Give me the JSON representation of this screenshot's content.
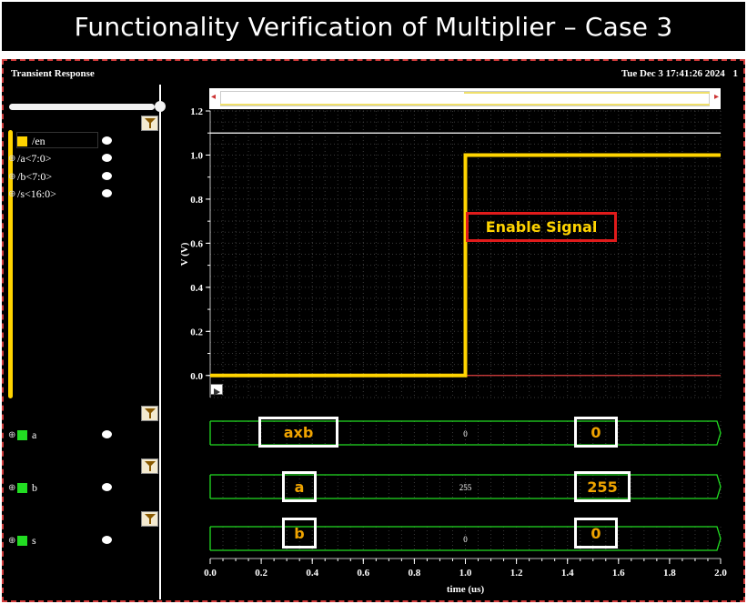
{
  "slide": {
    "title": "Functionality Verification of Multiplier – Case 3"
  },
  "window": {
    "title": "Transient Response",
    "datetime": "Tue Dec 3 17:41:26 2024",
    "subwindow_index": "1"
  },
  "sidebar": {
    "filter_icon": "funnel-icon",
    "signals": [
      {
        "name": "/en",
        "color": "#ffd400",
        "expand": ""
      },
      {
        "name": "/a<7:0>",
        "color": "",
        "expand": "⊕"
      },
      {
        "name": "/b<7:0>",
        "color": "",
        "expand": "⊕"
      },
      {
        "name": "/s<16:0>",
        "color": "",
        "expand": "⊕"
      }
    ],
    "bus_signals": [
      {
        "name": "a",
        "color": "#22dd22",
        "expand": "⊕"
      },
      {
        "name": "b",
        "color": "#22dd22",
        "expand": "⊕"
      },
      {
        "name": "s",
        "color": "#22dd22",
        "expand": "⊕"
      }
    ]
  },
  "annotations": {
    "enable_label": "Enable Signal",
    "bus_left_labels": [
      "axb",
      "a",
      "b"
    ],
    "bus_right_labels": [
      "0",
      "255",
      "0"
    ]
  },
  "chart_data": {
    "type": "line",
    "xlabel": "time (us)",
    "ylabel": "V (V)",
    "xlim": [
      0.0,
      2.0
    ],
    "ylim": [
      -0.1,
      1.2
    ],
    "x_ticks": [
      "0.0",
      "0.2",
      "0.4",
      "0.6",
      "0.8",
      "1.0",
      "1.2",
      "1.4",
      "1.6",
      "1.8",
      "2.0"
    ],
    "y_ticks": [
      "0.0",
      "0.2",
      "0.4",
      "0.6",
      "0.8",
      "1.0",
      "1.2"
    ],
    "grid": true,
    "series": [
      {
        "name": "/en",
        "color": "#ffd400",
        "points": [
          [
            0.0,
            0.0
          ],
          [
            1.0,
            0.0
          ],
          [
            1.0,
            1.0
          ],
          [
            2.0,
            1.0
          ]
        ]
      }
    ],
    "reference_lines": [
      {
        "y": 1.1,
        "color": "#ffffff",
        "x_from": 0.0,
        "x_to": 2.0
      },
      {
        "y": 0.0,
        "color": "#e04040",
        "x_from": 1.0,
        "x_to": 2.0
      }
    ],
    "buses": [
      {
        "name": "a",
        "value": "0",
        "color": "#22dd22"
      },
      {
        "name": "b",
        "value": "255",
        "color": "#22dd22"
      },
      {
        "name": "s",
        "value": "0",
        "color": "#22dd22"
      }
    ]
  }
}
